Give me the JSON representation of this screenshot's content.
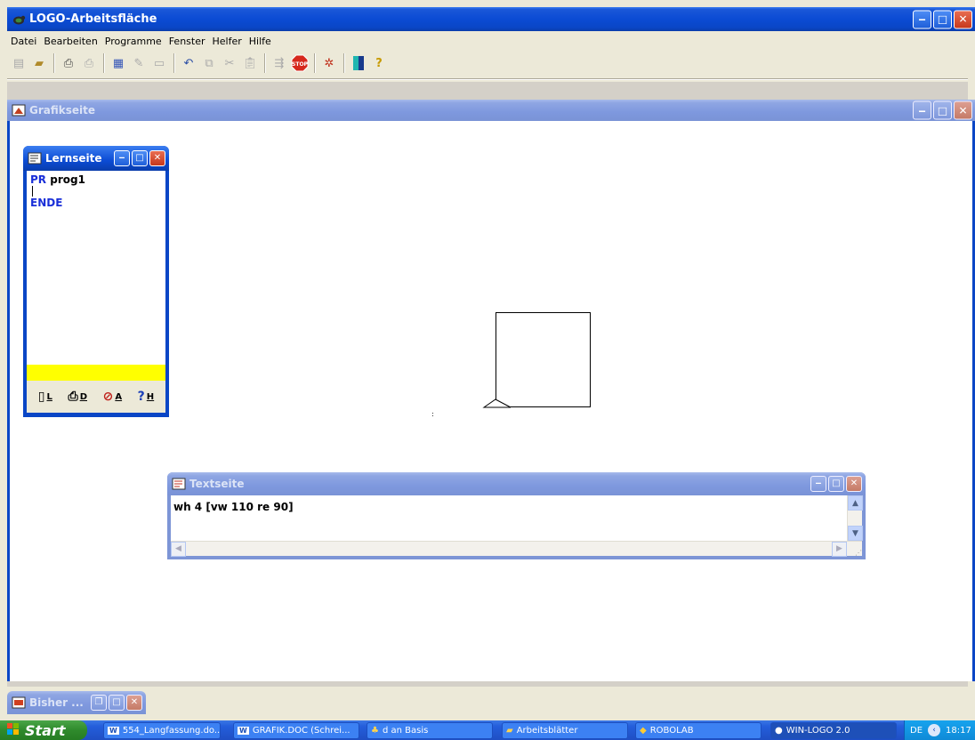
{
  "app": {
    "title": "LOGO-Arbeitsfläche"
  },
  "menu": [
    "Datei",
    "Bearbeiten",
    "Programme",
    "Fenster",
    "Helfer",
    "Hilfe"
  ],
  "toolbar": {
    "icons": [
      "new-icon",
      "open-icon",
      "print-icon",
      "print-preview-icon",
      "window-icon",
      "edit-icon",
      "cut-line-icon",
      "undo-icon",
      "copy-icon",
      "cut-icon",
      "paste-icon",
      "run-icon",
      "stop-icon",
      "save-image-icon",
      "color-icon",
      "help-icon"
    ]
  },
  "grafikseite": {
    "title": "Grafikseite"
  },
  "lernseite": {
    "title": "Lernseite",
    "code": {
      "kw1": "PR",
      "name": "prog1",
      "end": "ENDE"
    },
    "buttons": {
      "l": "L",
      "d": "D",
      "a": "A",
      "h": "H"
    }
  },
  "textseite": {
    "title": "Textseite",
    "command": "wh 4 [vw 110 re 90]"
  },
  "bisher": {
    "title": "Bisher ..."
  },
  "taskbar": {
    "start": "Start",
    "tasks": [
      "554_Langfassung.do...",
      "GRAFIK.DOC (Schrei...",
      "d an Basis",
      "Arbeitsblätter",
      "ROBOLAB",
      "WIN-LOGO 2.0"
    ],
    "lang": "DE",
    "clock": "18:17"
  },
  "colors": {
    "titlebar": "#0a46c6",
    "keyword": "#1a2fd8",
    "yellow": "#ffff00"
  }
}
